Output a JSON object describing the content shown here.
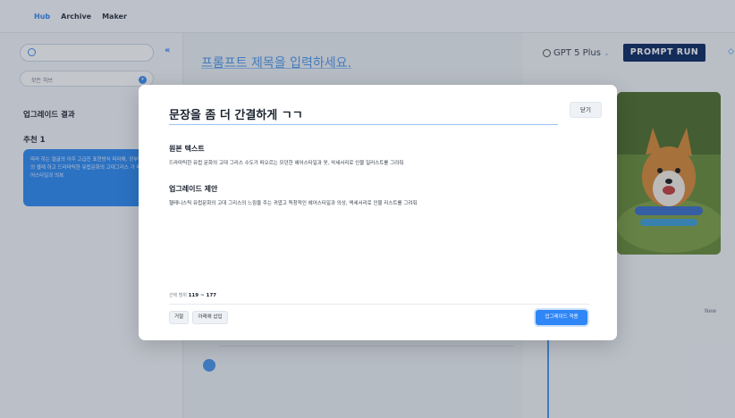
{
  "topbar": {
    "nav": [
      {
        "label": "Hub",
        "active": true
      },
      {
        "label": "Archive",
        "active": false
      },
      {
        "label": "Maker",
        "active": false
      }
    ]
  },
  "sidebar": {
    "search_placeholder": "",
    "collapse_icon": "«",
    "hub_select": "모든 허브",
    "result_title": "업그레이드 결과",
    "recommendation_title": "추천 1",
    "recommendation_text": "따라 하는 얼굴의 아주 고급진 표현방식 따라해, 정부한 이미지 속 인물의 옐레 하고 드라마틱한 유럽문화의 고대그리스 가 떠오르는 모던한 헤어스타일과 의복"
  },
  "main": {
    "title_placeholder": "프롬프트 제목을 입력하세요."
  },
  "right_panel": {
    "model": "GPT 5 Plus",
    "run_button": "PROMPT RUN",
    "new_label": "New"
  },
  "modal": {
    "title": "문장을 좀 더 간결하게 ㄱㄱ",
    "close_button": "닫기",
    "original_heading": "원본 텍스트",
    "original_text": "드라마틱한 유럽 문화의 고대 그리스 수도가 떠오르는 모던한 헤어스타일과 옷, 악세서리로 인물 일러스트를 그려줘",
    "upgrade_heading": "업그레이드 제안",
    "upgrade_text": "헬레니스틱 유럽문화의 고대 그리스의 느낌을 주는 귀엽고 독창적인 헤어스타일과 의상, 액세서리로 인물 리스트를 그려줘",
    "selection_label": "선택 범위",
    "selection_range": "119 ~ 177",
    "reject_button": "거절",
    "insert_below_button": "아래에 삽입",
    "apply_button": "업그레이드 적용"
  },
  "colors": {
    "accent": "#2f86f6",
    "run_button_bg": "#0d2a63",
    "overlay": "rgba(40,50,70,0.28)"
  }
}
